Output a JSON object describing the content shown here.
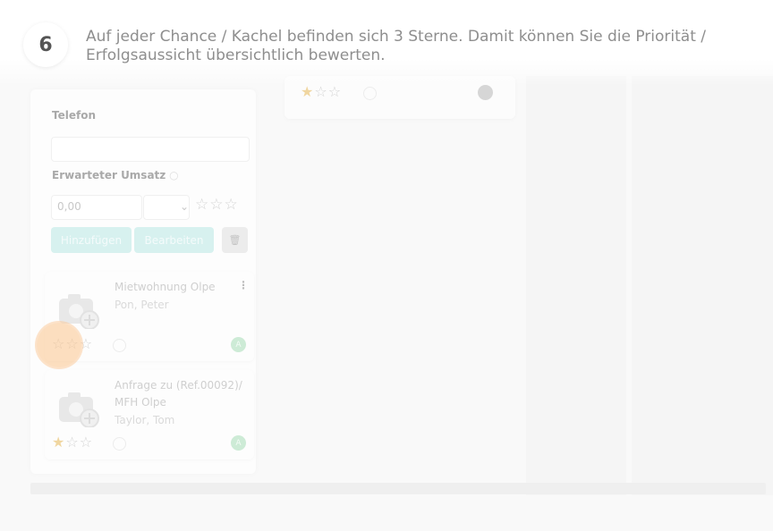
{
  "tutorial": {
    "step_number": "6",
    "text": "Auf jeder Chance / Kachel befinden sich 3 Sterne. Damit können Sie die Priorität / Erfolgsaussicht übersichtlich bewerten."
  },
  "form": {
    "phone_label": "Telefon",
    "phone_value": "",
    "revenue_label": "Erwarteter Umsatz",
    "revenue_value": "0,00",
    "star_rating": 0,
    "add_button": "Hinzufügen",
    "edit_button": "Bearbeiten",
    "delete_icon": "trash-icon"
  },
  "top_card": {
    "stars": "★☆☆",
    "star_rating": 1
  },
  "cards": [
    {
      "title": "Mietwohnung Olpe",
      "contact": "Pon, Peter",
      "stars": "☆☆☆",
      "star_rating": 0,
      "avatar": "A"
    },
    {
      "title": "Anfrage zu (Ref.00092)/ MFH Olpe",
      "contact": "Taylor, Tom",
      "stars": "★☆☆",
      "star_rating": 1,
      "avatar": "A"
    }
  ],
  "colors": {
    "accent": "#1bbcaa",
    "highlight": "#fcc48c",
    "star_active": "#f0b84a"
  }
}
